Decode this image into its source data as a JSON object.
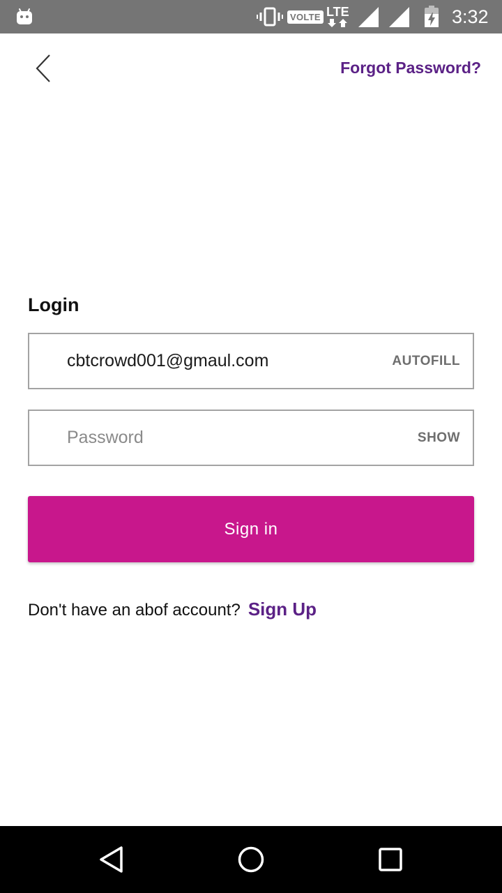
{
  "status_bar": {
    "volte_label": "VOLTE",
    "network_label": "LTE",
    "time": "3:32",
    "icons": [
      "android-icon",
      "vibrate-icon",
      "signal-icon",
      "battery-charging-icon"
    ]
  },
  "header": {
    "back_icon": "chevron-left-icon",
    "forgot_password": "Forgot Password?"
  },
  "form": {
    "title": "Login",
    "email": {
      "value": "cbtcrowd001@gmaul.com",
      "action": "AUTOFILL"
    },
    "password": {
      "value": "",
      "placeholder": "Password",
      "action": "SHOW"
    },
    "submit_label": "Sign in"
  },
  "signup": {
    "prompt": "Don't have an abof account?",
    "link": "Sign Up"
  },
  "nav_bar": {
    "icons": [
      "nav-back-icon",
      "nav-home-icon",
      "nav-recents-icon"
    ]
  },
  "colors": {
    "accent": "#5b2186",
    "button": "#c8178c",
    "status_bar": "#757575",
    "nav_bar": "#000000"
  }
}
